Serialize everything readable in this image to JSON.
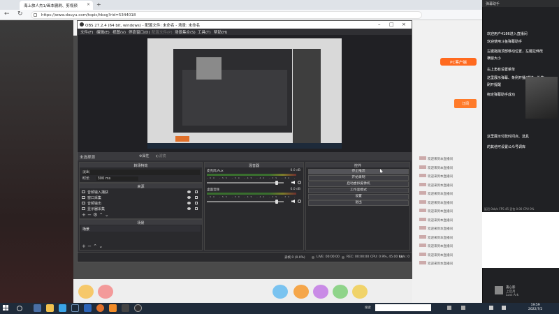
{
  "browser": {
    "tab_title": "海上旅人杰1/画本删刷、剪视频",
    "url": "https://www.douyu.com/topic/hbxg?rid=5344018"
  },
  "site": {
    "pc_client": "PC客户端",
    "follow": "订阅",
    "chat": [
      {
        "who": "",
        "text": "欢迎来到本直播间"
      },
      {
        "who": "",
        "text": "欢迎来到本直播间"
      },
      {
        "who": "",
        "text": "欢迎来到本直播间"
      },
      {
        "who": "",
        "text": "欢迎来到本直播间"
      },
      {
        "who": "",
        "text": "欢迎来到本直播间"
      },
      {
        "who": "",
        "text": "欢迎来到本直播间"
      },
      {
        "who": "",
        "text": "欢迎来到本直播间"
      },
      {
        "who": "",
        "text": "欢迎来到本直播间"
      },
      {
        "who": "",
        "text": "欢迎来到本直播间"
      },
      {
        "who": "",
        "text": "欢迎来到本直播间"
      },
      {
        "who": "",
        "text": "欢迎来到本直播间"
      },
      {
        "who": "",
        "text": "欢迎来到本直播间"
      },
      {
        "who": "",
        "text": "欢迎来到本直播间"
      }
    ]
  },
  "side_chat": {
    "header": "弹幕助手",
    "messages": [
      "欢迎用户4186进入直播间",
      "欢迎使用斗鱼弹幕助手",
      "左键拖拽顶部移动位置，左键拉伸改",
      "横窗大小",
      "右上角有设置菜单",
      "这里展示弹幕、条例开播/成绩，礼物",
      "刷开提醒",
      "绑定弹幕助手成功",
      "这里展示付款时间点、选具",
      "的其他可设置公众号调库"
    ],
    "stats": "延迟 0kb/s FPS 45 丢包 0.00 CPU 0%",
    "music_title": "夜心影",
    "music_artist": "上官月",
    "music_sub": "Lost Ark"
  },
  "obs": {
    "title": "OBS 27.2.4 (64 bit, windows) - 配置文件: 未命名 - 场景: 未命名",
    "menus": [
      "文件(F)",
      "编辑(E)",
      "视图(V)",
      "停靠窗口(D)",
      "配置文件(P)",
      "场景集合(S)",
      "工具(T)",
      "帮助(H)"
    ],
    "no_source": "未选择源",
    "properties": "属性",
    "filters": "滤镜",
    "transitions": {
      "title": "转场特效",
      "type": "淡出",
      "duration_label": "时长",
      "duration": "300 ms"
    },
    "sources": {
      "title": "来源",
      "items": [
        "音频输入捕获",
        "窗口采集",
        "音频输出",
        "显示器采集"
      ]
    },
    "scenes": {
      "title": "场景",
      "items": [
        "场景"
      ]
    },
    "mixer": {
      "title": "混音器",
      "channels": [
        {
          "name": "麦克风/Aux",
          "db": "0.0 dB"
        },
        {
          "name": "桌面音频",
          "db": "0.0 dB"
        }
      ],
      "ticks": "-60 -55 -50 -45 -40 -35 -30 -25 -20 -15 -10 -5 0"
    },
    "controls": {
      "title": "控件",
      "buttons": [
        "停止推流",
        "开始录制",
        "启动虚拟摄像机",
        "工作室模式",
        "设置",
        "退出"
      ]
    },
    "status": {
      "dropped": "丢帧 0 (0.0%)",
      "live": "LIVE: 00:00:00",
      "rec": "REC: 00:00:00",
      "cpu": "CPU: 0.9%, 45.00 fps",
      "kbps": "kb/s: 0"
    }
  },
  "taskbar": {
    "search_label": "搜索",
    "time": "19:59",
    "date": "2022/7/2"
  }
}
